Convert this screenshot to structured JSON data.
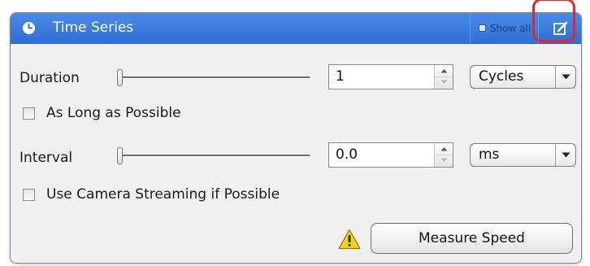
{
  "header": {
    "title": "Time Series",
    "clock_icon": "clock-icon",
    "show_all_label": "Show all",
    "edit_icon": "edit-icon"
  },
  "duration": {
    "label": "Duration",
    "slider_level": 0,
    "value": "1",
    "unit": "Cycles"
  },
  "as_long_as_possible": {
    "label": "As Long as Possible",
    "checked": false
  },
  "interval": {
    "label": "Interval",
    "slider_level": 0,
    "value": "0.0",
    "unit": "ms"
  },
  "camera_streaming": {
    "label": "Use Camera Streaming if Possible",
    "checked": false
  },
  "measure": {
    "warning_icon": "warning-icon",
    "button_label": "Measure Speed"
  },
  "colors": {
    "header_blue": "#2f6fd6",
    "highlight_red": "#e3262a",
    "warning_yellow": "#f2d21b"
  }
}
